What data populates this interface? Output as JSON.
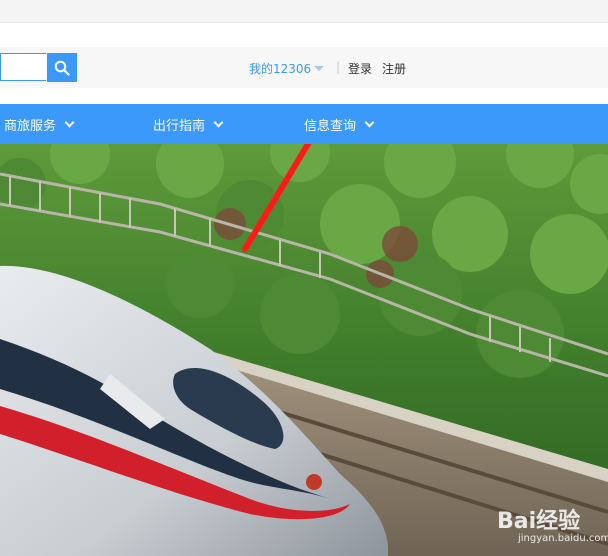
{
  "header": {
    "search": {
      "value": "",
      "placeholder": ""
    },
    "my12306": "我的12306",
    "separator": "|",
    "login": "登录",
    "register": "注册"
  },
  "nav": {
    "items": [
      {
        "label": "商旅服务"
      },
      {
        "label": "出行指南"
      },
      {
        "label": "信息查询"
      }
    ]
  },
  "watermark": {
    "logo": "Bai经验",
    "url": "jingyan.baidu.com"
  },
  "colors": {
    "accent": "#3b99fc",
    "arrow": "#ff1a1a",
    "train_red": "#d21f2c"
  }
}
